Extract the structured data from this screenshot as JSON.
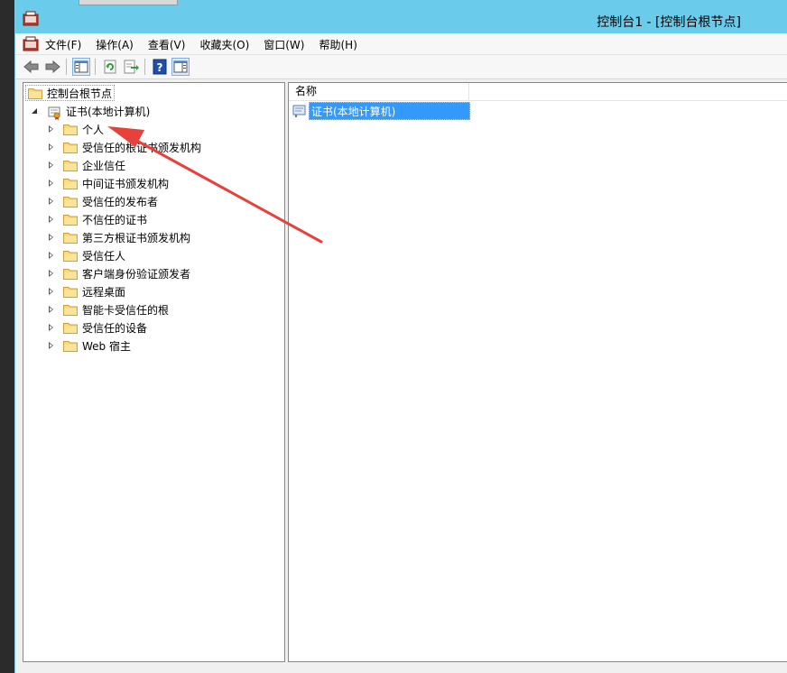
{
  "window": {
    "title": "控制台1 - [控制台根节点]"
  },
  "menu": {
    "items": [
      {
        "label": "文件(F)"
      },
      {
        "label": "操作(A)"
      },
      {
        "label": "查看(V)"
      },
      {
        "label": "收藏夹(O)"
      },
      {
        "label": "窗口(W)"
      },
      {
        "label": "帮助(H)"
      }
    ]
  },
  "toolbar": {
    "buttons": [
      "back-icon",
      "forward-icon",
      "show-hide-tree-icon",
      "refresh-icon",
      "export-list-icon",
      "help-icon",
      "show-hide-action-pane-icon"
    ]
  },
  "tree": {
    "root": "控制台根节点",
    "store": "证书(本地计算机)",
    "folders": [
      "个人",
      "受信任的根证书颁发机构",
      "企业信任",
      "中间证书颁发机构",
      "受信任的发布者",
      "不信任的证书",
      "第三方根证书颁发机构",
      "受信任人",
      "客户端身份验证颁发者",
      "远程桌面",
      "智能卡受信任的根",
      "受信任的设备",
      "Web 宿主"
    ]
  },
  "list": {
    "column_name": "名称",
    "items": [
      {
        "label": "证书(本地计算机)",
        "selected": true
      }
    ]
  },
  "annotation": {
    "arrow_color": "#e8403a"
  },
  "colors": {
    "titlebar": "#6bcbeb",
    "selection": "#3399ff"
  }
}
